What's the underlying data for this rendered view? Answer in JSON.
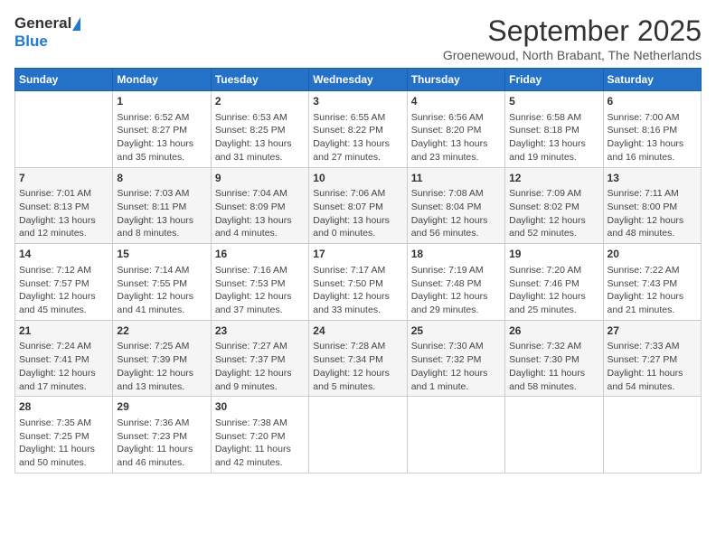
{
  "logo": {
    "general": "General",
    "blue": "Blue"
  },
  "title": {
    "month_year": "September 2025",
    "location": "Groenewoud, North Brabant, The Netherlands"
  },
  "headers": [
    "Sunday",
    "Monday",
    "Tuesday",
    "Wednesday",
    "Thursday",
    "Friday",
    "Saturday"
  ],
  "weeks": [
    [
      {
        "day": "",
        "content": ""
      },
      {
        "day": "1",
        "content": "Sunrise: 6:52 AM\nSunset: 8:27 PM\nDaylight: 13 hours\nand 35 minutes."
      },
      {
        "day": "2",
        "content": "Sunrise: 6:53 AM\nSunset: 8:25 PM\nDaylight: 13 hours\nand 31 minutes."
      },
      {
        "day": "3",
        "content": "Sunrise: 6:55 AM\nSunset: 8:22 PM\nDaylight: 13 hours\nand 27 minutes."
      },
      {
        "day": "4",
        "content": "Sunrise: 6:56 AM\nSunset: 8:20 PM\nDaylight: 13 hours\nand 23 minutes."
      },
      {
        "day": "5",
        "content": "Sunrise: 6:58 AM\nSunset: 8:18 PM\nDaylight: 13 hours\nand 19 minutes."
      },
      {
        "day": "6",
        "content": "Sunrise: 7:00 AM\nSunset: 8:16 PM\nDaylight: 13 hours\nand 16 minutes."
      }
    ],
    [
      {
        "day": "7",
        "content": "Sunrise: 7:01 AM\nSunset: 8:13 PM\nDaylight: 13 hours\nand 12 minutes."
      },
      {
        "day": "8",
        "content": "Sunrise: 7:03 AM\nSunset: 8:11 PM\nDaylight: 13 hours\nand 8 minutes."
      },
      {
        "day": "9",
        "content": "Sunrise: 7:04 AM\nSunset: 8:09 PM\nDaylight: 13 hours\nand 4 minutes."
      },
      {
        "day": "10",
        "content": "Sunrise: 7:06 AM\nSunset: 8:07 PM\nDaylight: 13 hours\nand 0 minutes."
      },
      {
        "day": "11",
        "content": "Sunrise: 7:08 AM\nSunset: 8:04 PM\nDaylight: 12 hours\nand 56 minutes."
      },
      {
        "day": "12",
        "content": "Sunrise: 7:09 AM\nSunset: 8:02 PM\nDaylight: 12 hours\nand 52 minutes."
      },
      {
        "day": "13",
        "content": "Sunrise: 7:11 AM\nSunset: 8:00 PM\nDaylight: 12 hours\nand 48 minutes."
      }
    ],
    [
      {
        "day": "14",
        "content": "Sunrise: 7:12 AM\nSunset: 7:57 PM\nDaylight: 12 hours\nand 45 minutes."
      },
      {
        "day": "15",
        "content": "Sunrise: 7:14 AM\nSunset: 7:55 PM\nDaylight: 12 hours\nand 41 minutes."
      },
      {
        "day": "16",
        "content": "Sunrise: 7:16 AM\nSunset: 7:53 PM\nDaylight: 12 hours\nand 37 minutes."
      },
      {
        "day": "17",
        "content": "Sunrise: 7:17 AM\nSunset: 7:50 PM\nDaylight: 12 hours\nand 33 minutes."
      },
      {
        "day": "18",
        "content": "Sunrise: 7:19 AM\nSunset: 7:48 PM\nDaylight: 12 hours\nand 29 minutes."
      },
      {
        "day": "19",
        "content": "Sunrise: 7:20 AM\nSunset: 7:46 PM\nDaylight: 12 hours\nand 25 minutes."
      },
      {
        "day": "20",
        "content": "Sunrise: 7:22 AM\nSunset: 7:43 PM\nDaylight: 12 hours\nand 21 minutes."
      }
    ],
    [
      {
        "day": "21",
        "content": "Sunrise: 7:24 AM\nSunset: 7:41 PM\nDaylight: 12 hours\nand 17 minutes."
      },
      {
        "day": "22",
        "content": "Sunrise: 7:25 AM\nSunset: 7:39 PM\nDaylight: 12 hours\nand 13 minutes."
      },
      {
        "day": "23",
        "content": "Sunrise: 7:27 AM\nSunset: 7:37 PM\nDaylight: 12 hours\nand 9 minutes."
      },
      {
        "day": "24",
        "content": "Sunrise: 7:28 AM\nSunset: 7:34 PM\nDaylight: 12 hours\nand 5 minutes."
      },
      {
        "day": "25",
        "content": "Sunrise: 7:30 AM\nSunset: 7:32 PM\nDaylight: 12 hours\nand 1 minute."
      },
      {
        "day": "26",
        "content": "Sunrise: 7:32 AM\nSunset: 7:30 PM\nDaylight: 11 hours\nand 58 minutes."
      },
      {
        "day": "27",
        "content": "Sunrise: 7:33 AM\nSunset: 7:27 PM\nDaylight: 11 hours\nand 54 minutes."
      }
    ],
    [
      {
        "day": "28",
        "content": "Sunrise: 7:35 AM\nSunset: 7:25 PM\nDaylight: 11 hours\nand 50 minutes."
      },
      {
        "day": "29",
        "content": "Sunrise: 7:36 AM\nSunset: 7:23 PM\nDaylight: 11 hours\nand 46 minutes."
      },
      {
        "day": "30",
        "content": "Sunrise: 7:38 AM\nSunset: 7:20 PM\nDaylight: 11 hours\nand 42 minutes."
      },
      {
        "day": "",
        "content": ""
      },
      {
        "day": "",
        "content": ""
      },
      {
        "day": "",
        "content": ""
      },
      {
        "day": "",
        "content": ""
      }
    ]
  ]
}
